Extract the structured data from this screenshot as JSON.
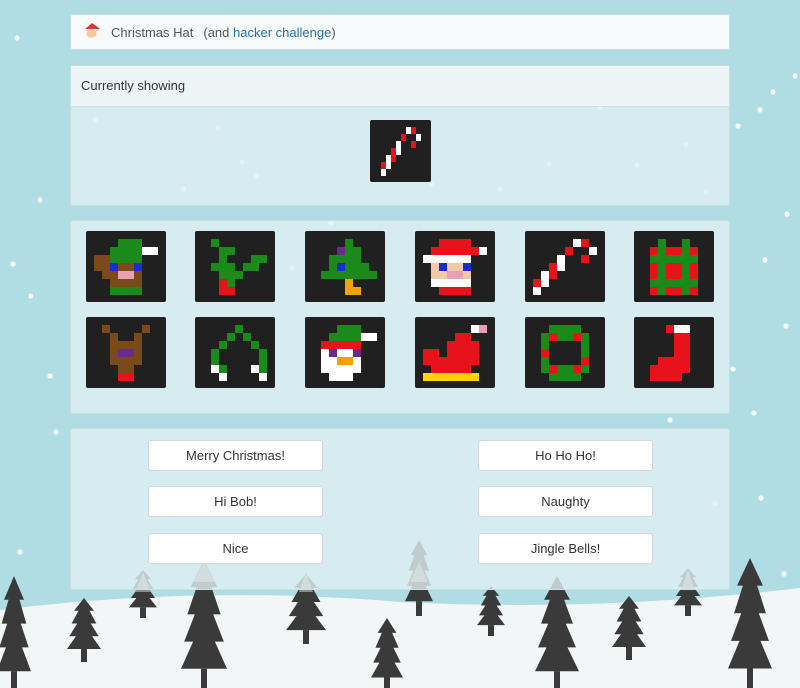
{
  "header": {
    "title": "Christmas Hat",
    "paren_open": "(and",
    "link_text": "hacker challenge",
    "paren_close": ")"
  },
  "showing": {
    "heading": "Currently showing",
    "current_icon": "candy-cane-icon"
  },
  "gallery": {
    "icons": [
      "elf-icon",
      "holly-icon",
      "christmas-tree-icon",
      "santa-icon",
      "candy-cane-icon",
      "present-icon",
      "reindeer-icon",
      "mistletoe-icon",
      "snowman-icon",
      "sleigh-icon",
      "wreath-icon",
      "stocking-icon"
    ]
  },
  "messages": {
    "buttons": [
      "Merry Christmas!",
      "Ho Ho Ho!",
      "Hi Bob!",
      "Naughty",
      "Nice",
      "Jingle Bells!"
    ]
  },
  "colors": {
    "background": "#b0dde4",
    "tile": "#222222",
    "link": "#2a6fb0"
  }
}
